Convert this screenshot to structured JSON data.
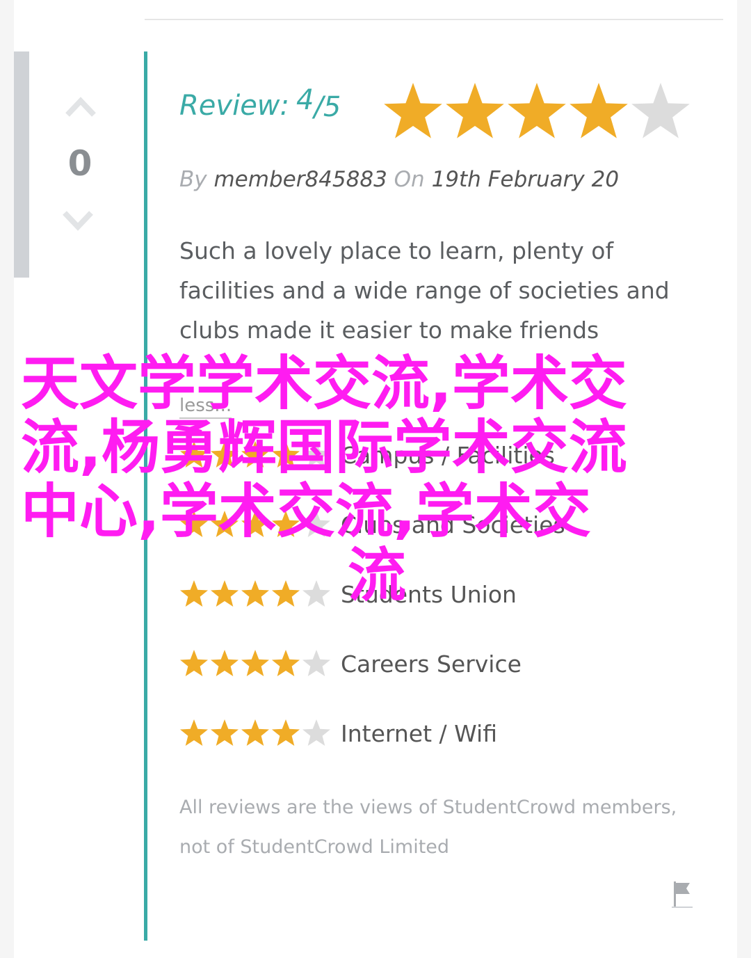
{
  "vote": {
    "count": "0"
  },
  "review": {
    "label": "Review:",
    "score": "4",
    "out_of": "/5",
    "rating": 4,
    "max": 5
  },
  "byline": {
    "by": "By",
    "member": "member845883",
    "on": "On",
    "date": "19th February 20"
  },
  "body": "Such a lovely place to learn, plenty of facilities and a wide range of societies and clubs made it easier to make friends",
  "read_less": "less...",
  "categories": [
    {
      "label": "Campus / Facilities",
      "rating": 4
    },
    {
      "label": "Clubs and Societies",
      "rating": 4
    },
    {
      "label": "Students Union",
      "rating": 4
    },
    {
      "label": "Careers Service",
      "rating": 4
    },
    {
      "label": "Internet / Wifi",
      "rating": 4
    }
  ],
  "disclaimer": "All reviews are the views of StudentCrowd members, not of StudentCrowd Limited",
  "overlay": {
    "line1": "天文学学术交流,学术交",
    "line2": "流,杨勇辉国际学术交流",
    "line3": "中心,学术交流,学术交",
    "line4": "流"
  },
  "colors": {
    "accent": "#3aaaa6",
    "star_on": "#f0ac27",
    "star_off": "#dcdcdc",
    "overlay": "#ff1cf1"
  },
  "icons": [
    "chevron-up-icon",
    "chevron-down-icon",
    "star-icon",
    "flag-icon"
  ]
}
